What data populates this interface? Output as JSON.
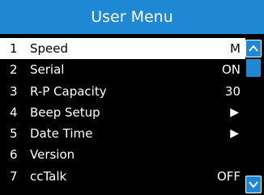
{
  "title": "User Menu",
  "menu": {
    "items": [
      {
        "num": "1",
        "label": "Speed",
        "value": "M"
      },
      {
        "num": "2",
        "label": "Serial",
        "value": "ON"
      },
      {
        "num": "3",
        "label": "R-P Capacity",
        "value": "30"
      },
      {
        "num": "4",
        "label": "Beep Setup",
        "value": "▶"
      },
      {
        "num": "5",
        "label": "Date Time",
        "value": "▶"
      },
      {
        "num": "6",
        "label": "Version",
        "value": ""
      },
      {
        "num": "7",
        "label": "ccTalk",
        "value": "OFF"
      }
    ],
    "selected_index": 0
  },
  "scrollbar": {
    "up_icon": "chevron-up-icon",
    "down_icon": "chevron-down-icon"
  },
  "colors": {
    "accent": "#1e88d4",
    "background": "#000000",
    "text": "#ffffff",
    "selected_bg": "#ffffff",
    "selected_text": "#000000"
  }
}
